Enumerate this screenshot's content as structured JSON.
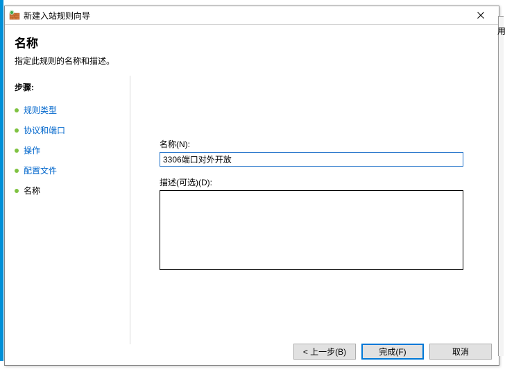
{
  "titlebar": {
    "title": "新建入站规则向导"
  },
  "header": {
    "title": "名称",
    "subtitle": "指定此规则的名称和描述。"
  },
  "steps": {
    "heading": "步骤:",
    "items": [
      {
        "label": "规则类型"
      },
      {
        "label": "协议和端口"
      },
      {
        "label": "操作"
      },
      {
        "label": "配置文件"
      },
      {
        "label": "名称"
      }
    ]
  },
  "form": {
    "name_label": "名称(N):",
    "name_value": "3306端口对外开放",
    "desc_label": "描述(可选)(D):",
    "desc_value": ""
  },
  "footer": {
    "back": "< 上一步(B)",
    "finish": "完成(F)",
    "cancel": "取消"
  },
  "side_label": "用"
}
